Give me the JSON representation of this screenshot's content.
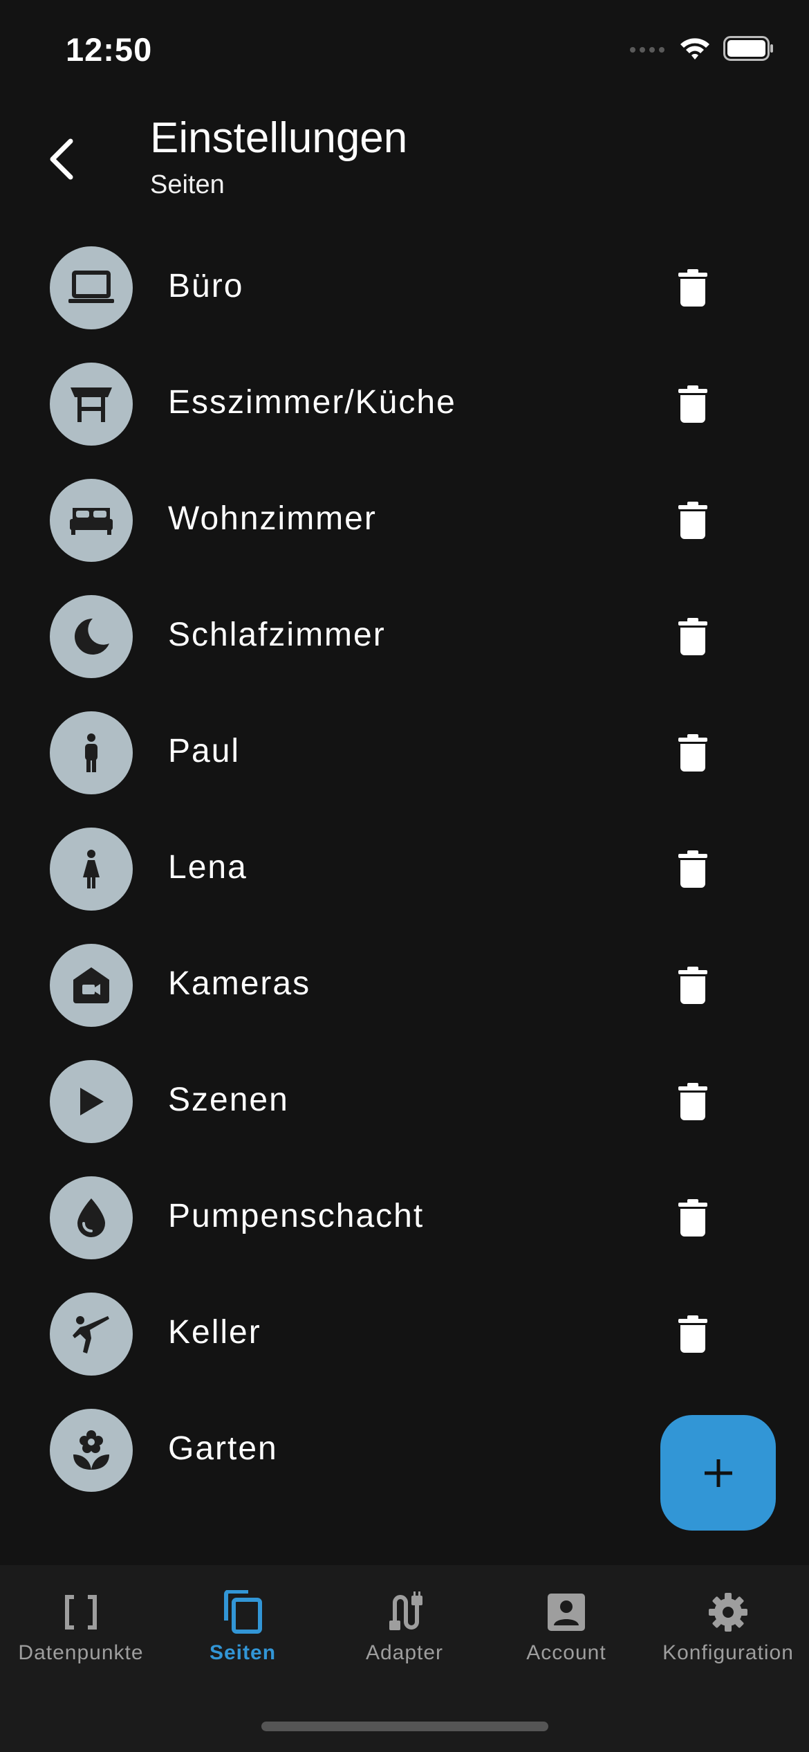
{
  "status_bar": {
    "time": "12:50",
    "icons": [
      "signal-dots-icon",
      "wifi-icon",
      "battery-icon"
    ]
  },
  "header": {
    "back_icon": "chevron-left-icon",
    "title": "Einstellungen",
    "subtitle": "Seiten"
  },
  "pages": [
    {
      "label": "Büro",
      "icon": "laptop-icon",
      "deletable": true
    },
    {
      "label": "Esszimmer/Küche",
      "icon": "dining-table-icon",
      "deletable": true
    },
    {
      "label": "Wohnzimmer",
      "icon": "bed-icon",
      "deletable": true
    },
    {
      "label": "Schlafzimmer",
      "icon": "moon-icon",
      "deletable": true
    },
    {
      "label": "Paul",
      "icon": "man-icon",
      "deletable": true
    },
    {
      "label": "Lena",
      "icon": "woman-icon",
      "deletable": true
    },
    {
      "label": "Kameras",
      "icon": "home-camera-icon",
      "deletable": true
    },
    {
      "label": "Szenen",
      "icon": "play-icon",
      "deletable": true
    },
    {
      "label": "Pumpenschacht",
      "icon": "water-drop-icon",
      "deletable": true
    },
    {
      "label": "Keller",
      "icon": "karate-icon",
      "deletable": true
    },
    {
      "label": "Garten",
      "icon": "flower-icon",
      "deletable": false
    }
  ],
  "fab": {
    "icon": "plus-icon"
  },
  "bottom_nav": [
    {
      "label": "Datenpunkte",
      "icon": "brackets-icon",
      "active": false
    },
    {
      "label": "Seiten",
      "icon": "copy-pages-icon",
      "active": true
    },
    {
      "label": "Adapter",
      "icon": "cable-icon",
      "active": false
    },
    {
      "label": "Account",
      "icon": "account-box-icon",
      "active": false
    },
    {
      "label": "Konfiguration",
      "icon": "gear-icon",
      "active": false
    }
  ],
  "colors": {
    "background": "#131313",
    "avatar": "#b0bec5",
    "accent": "#3296d6",
    "nav_background": "#1b1b1b",
    "nav_inactive": "#9e9e9e"
  }
}
